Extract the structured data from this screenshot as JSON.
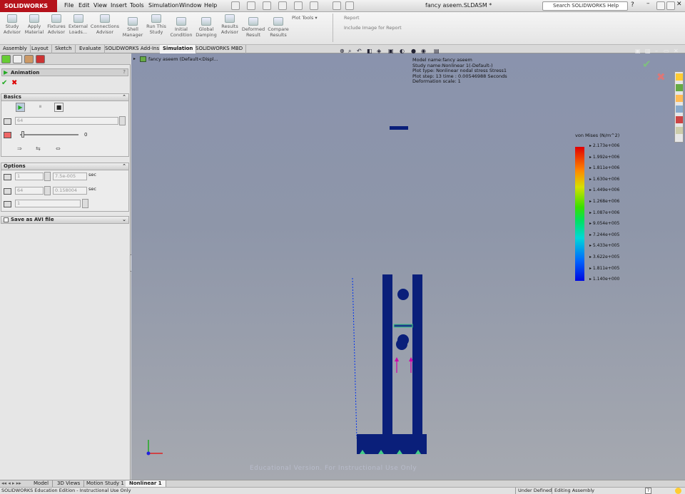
{
  "app": {
    "name": "SOLIDWORKS",
    "document_title": "fancy aseem.SLDASM *"
  },
  "menu": [
    "File",
    "Edit",
    "View",
    "Insert",
    "Tools",
    "Simulation",
    "Window",
    "Help"
  ],
  "search": {
    "label": "Search SOLIDWORKS Help"
  },
  "ribbon": {
    "buttons": [
      {
        "label": "Study\nAdvisor",
        "icon": "study-advisor-icon"
      },
      {
        "label": "Apply\nMaterial",
        "icon": "apply-material-icon"
      },
      {
        "label": "Fixtures\nAdvisor",
        "icon": "fixtures-icon"
      },
      {
        "label": "External\nLoads...",
        "icon": "external-loads-icon"
      },
      {
        "label": "Connections\nAdvisor",
        "icon": "connections-icon"
      },
      {
        "label": "Shell\nManager",
        "icon": "shell-manager-icon"
      },
      {
        "label": "Run This\nStudy",
        "icon": "run-study-icon"
      },
      {
        "label": "Initial\nCondition",
        "icon": "initial-condition-icon"
      },
      {
        "label": "Global\nDamping",
        "icon": "global-damping-icon"
      },
      {
        "label": "Results\nAdvisor",
        "icon": "results-advisor-icon"
      },
      {
        "label": "Deformed\nResult",
        "icon": "deformed-result-icon"
      },
      {
        "label": "Compare\nResults",
        "icon": "compare-results-icon"
      }
    ],
    "plot_tools": "Plot Tools",
    "report": "Report",
    "include_image": "Include Image for Report"
  },
  "tabs": [
    "Assembly",
    "Layout",
    "Sketch",
    "Evaluate",
    "SOLIDWORKS Add-Ins",
    "Simulation",
    "SOLIDWORKS MBD"
  ],
  "active_tab": "Simulation",
  "tree_root": "fancy aseem  (Default<Displ...",
  "panel": {
    "title": "Animation",
    "basics": {
      "header": "Basics",
      "frames_value": "64",
      "speed_value": "0"
    },
    "options": {
      "header": "Options",
      "start_step": "1",
      "start_time": "7.5e-005",
      "end_step": "64",
      "end_time": "0.158004",
      "unit": "sec",
      "step": "1"
    },
    "save_avi": "Save as AVI file"
  },
  "plot_info": [
    "Model name:fancy aseem",
    "Study name:Nonlinear 1(-Default-)",
    "Plot type: Nonlinear nodal stress Stress1",
    "Plot step: 13    time : 0.00546988 Seconds",
    "Deformation scale: 1"
  ],
  "legend": {
    "title": "von Mises (N/m^2)",
    "values": [
      "2.173e+006",
      "1.992e+006",
      "1.811e+006",
      "1.630e+006",
      "1.449e+006",
      "1.268e+006",
      "1.087e+006",
      "9.054e+005",
      "7.244e+005",
      "5.433e+005",
      "3.622e+005",
      "1.811e+005",
      "1.140e+000"
    ],
    "colors": {
      "high": "#e00000",
      "low": "#0008e0"
    }
  },
  "model_color": "#0a1f7a",
  "watermark": "Educational Version. For Instructional Use Only",
  "bottom_tabs": [
    "Model",
    "3D Views",
    "Motion Study 1",
    "Nonlinear 1"
  ],
  "active_bottom_tab": "Nonlinear 1",
  "status": {
    "left": "SOLIDWORKS Education Edition - Instructional Use Only",
    "under_defined": "Under Defined",
    "editing": "Editing Assembly"
  }
}
